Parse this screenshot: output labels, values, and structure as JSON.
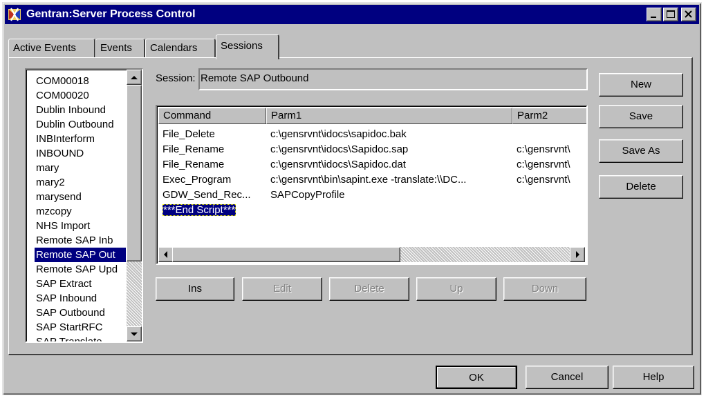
{
  "window": {
    "title": "Gentran:Server Process Control"
  },
  "tabs": [
    {
      "label": "Active Events",
      "active": false
    },
    {
      "label": "Events",
      "active": false
    },
    {
      "label": "Calendars",
      "active": false
    },
    {
      "label": "Sessions",
      "active": true
    }
  ],
  "sessions_list": {
    "items": [
      "COM00018",
      "COM00020",
      "Dublin Inbound",
      "Dublin Outbound",
      "INBInterform",
      "INBOUND",
      "mary",
      "mary2",
      "marysend",
      "mzcopy",
      "NHS Import",
      "Remote SAP Inb",
      "Remote SAP Out",
      "Remote SAP Upd",
      "SAP Extract",
      "SAP Inbound",
      "SAP Outbound",
      "SAP StartRFC",
      "SAP Translate"
    ],
    "selected_index": 12
  },
  "session": {
    "label": "Session:",
    "value": "Remote SAP Outbound"
  },
  "grid": {
    "columns": [
      "Command",
      "Parm1",
      "Parm2"
    ],
    "rows": [
      [
        "File_Delete",
        "c:\\gensrvnt\\idocs\\sapidoc.bak",
        ""
      ],
      [
        "File_Rename",
        "c:\\gensrvnt\\idocs\\Sapidoc.sap",
        "c:\\gensrvnt\\"
      ],
      [
        "File_Rename",
        "c:\\gensrvnt\\idocs\\Sapidoc.dat",
        "c:\\gensrvnt\\"
      ],
      [
        "Exec_Program",
        "c:\\gensrvnt\\bin\\sapint.exe -translate:\\\\DC...",
        "c:\\gensrvnt\\"
      ],
      [
        "GDW_Send_Rec...",
        "SAPCopyProfile",
        ""
      ],
      [
        "***End Script***",
        "",
        ""
      ]
    ],
    "selected_row": 5
  },
  "side_buttons": {
    "new": "New",
    "save": "Save",
    "save_as": "Save As",
    "delete": "Delete"
  },
  "command_buttons": {
    "ins": "Ins",
    "edit": "Edit",
    "delete": "Delete",
    "up": "Up",
    "down": "Down"
  },
  "dialog_buttons": {
    "ok": "OK",
    "cancel": "Cancel",
    "help": "Help"
  },
  "colors": {
    "title_bar": "#000080",
    "face": "#c0c0c0",
    "selection": "#000080"
  },
  "icons": {
    "app": "gentran-app-icon",
    "minimize": "minimize-icon",
    "maximize": "maximize-icon",
    "close": "close-icon"
  }
}
